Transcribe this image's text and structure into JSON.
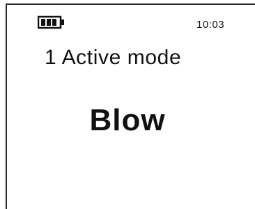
{
  "status_bar": {
    "battery_icon": "battery-full-icon",
    "battery_level": 1.0,
    "time": "10:03"
  },
  "display": {
    "mode_title": "1 Active mode",
    "mode_value": "Blow"
  }
}
